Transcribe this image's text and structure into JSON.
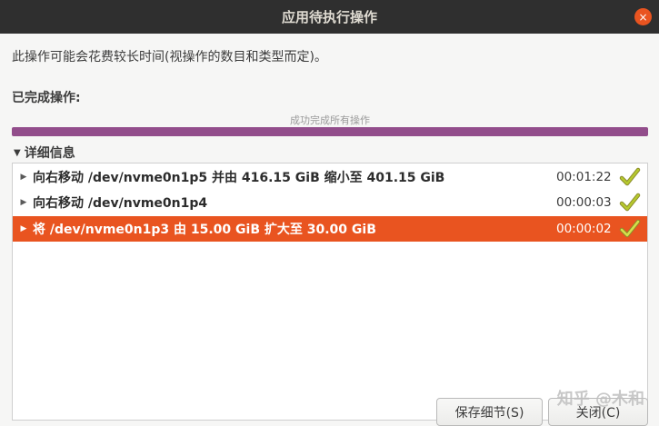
{
  "window": {
    "title": "应用待执行操作",
    "close_icon": "×"
  },
  "description": "此操作可能会花费较长时间(视操作的数目和类型而定)。",
  "completed_label": "已完成操作:",
  "progress": {
    "text": "成功完成所有操作",
    "fraction": 1.0,
    "color": "#924d8b"
  },
  "details": {
    "label": "详细信息",
    "expanded": true
  },
  "operations": [
    {
      "label": "向右移动 /dev/nvme0n1p5 并由 416.15 GiB 缩小至 401.15 GiB",
      "time": "00:01:22",
      "status_icon": "check-icon"
    },
    {
      "label": "向右移动 /dev/nvme0n1p4",
      "time": "00:00:03",
      "status_icon": "check-icon"
    },
    {
      "label": "将 /dev/nvme0n1p3 由 15.00 GiB 扩大至 30.00 GiB",
      "time": "00:00:02",
      "status_icon": "check-icon",
      "selected": true
    }
  ],
  "buttons": {
    "save_details": "保存细节(S)",
    "close": "关闭(C)"
  },
  "watermark": "知乎 @木和",
  "colors": {
    "accent": "#e95420",
    "titlebar": "#2f2f2f"
  }
}
